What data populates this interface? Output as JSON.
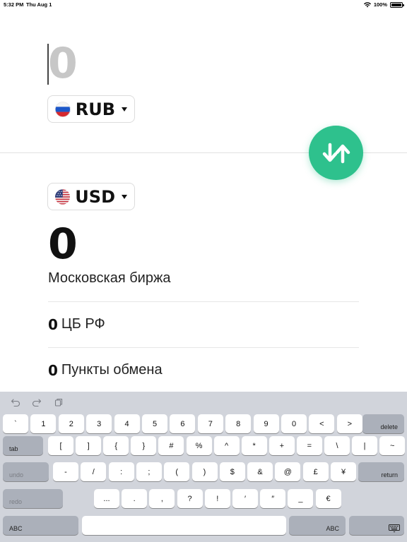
{
  "status_bar": {
    "time": "5:32 PM",
    "date": "Thu Aug 1",
    "battery": "100%",
    "battery_level": 1.0,
    "wifi_icon": "wifi-icon"
  },
  "source": {
    "amount": "0",
    "currency": "RUB",
    "flag": "russia-flag-icon"
  },
  "swap": {
    "icon": "swap-arrows-icon",
    "color": "#2ec18d"
  },
  "target": {
    "amount": "0",
    "currency": "USD",
    "flag": "usa-flag-icon",
    "exchange_label": "Московская биржа"
  },
  "rates": [
    {
      "value": "0",
      "label": "ЦБ РФ"
    },
    {
      "value": "0",
      "label": "Пункты обмена"
    }
  ],
  "keyboard": {
    "toolbar": [
      "undo-arrow-icon",
      "redo-arrow-icon",
      "paste-icon"
    ],
    "row1": [
      "`",
      "1",
      "2",
      "3",
      "4",
      "5",
      "6",
      "7",
      "8",
      "9",
      "0",
      "<",
      ">"
    ],
    "delete": "delete",
    "tab": "tab",
    "row2": [
      "[",
      "]",
      "{",
      "}",
      "#",
      "%",
      "^",
      "*",
      "+",
      "=",
      "\\",
      "|",
      "~"
    ],
    "undo": "undo",
    "row3": [
      "-",
      "/",
      ":",
      ";",
      "(",
      ")",
      "$",
      "&",
      "@",
      "£",
      "¥"
    ],
    "return": "return",
    "redo": "redo",
    "row4": [
      "...",
      ".",
      ",",
      "?",
      "!",
      "′",
      "″",
      "_",
      "€"
    ],
    "abc_left": "ABC",
    "abc_right": "ABC",
    "dismiss_icon": "keyboard-dismiss-icon"
  }
}
